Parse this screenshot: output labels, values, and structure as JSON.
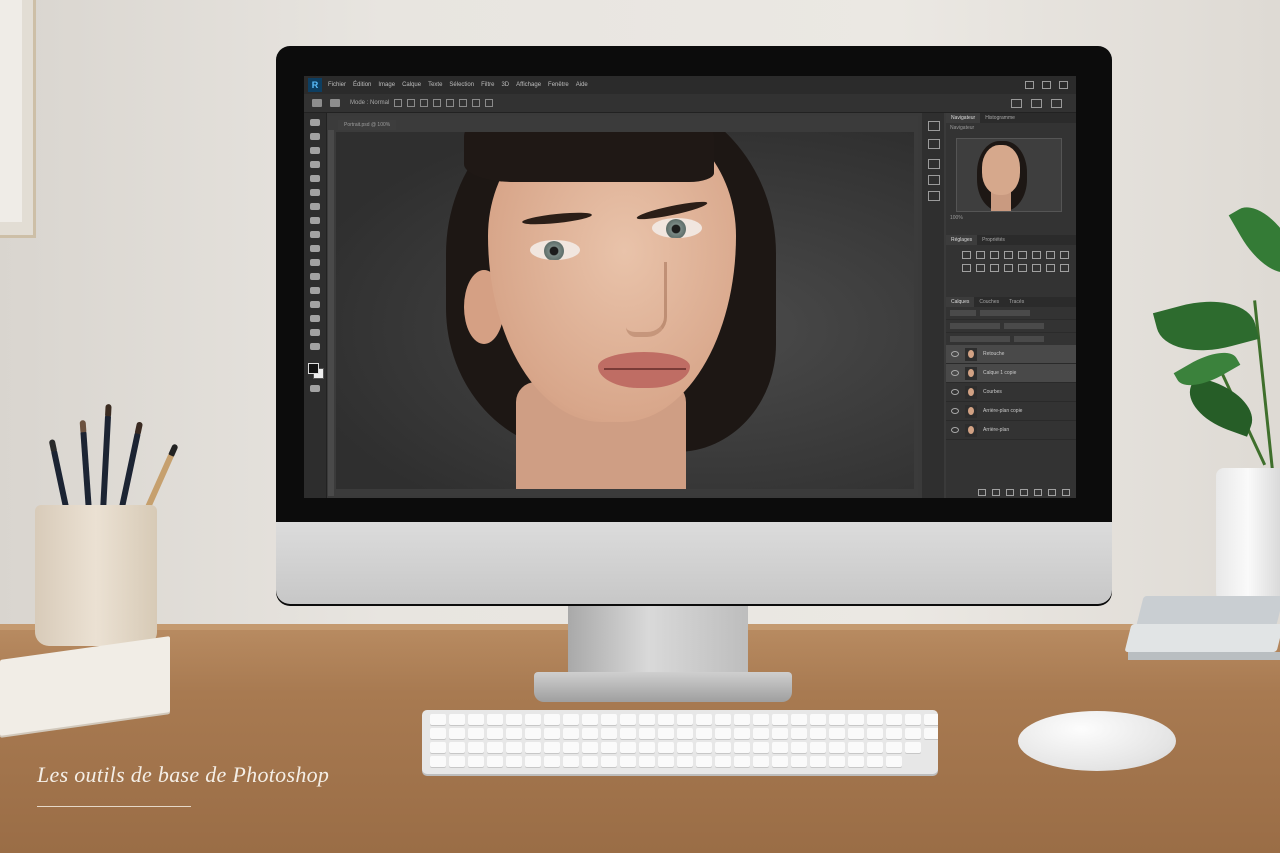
{
  "caption": "Les outils de base de Photoshop",
  "app": {
    "logo_text": "R",
    "menu": [
      "Fichier",
      "Édition",
      "Image",
      "Calque",
      "Texte",
      "Sélection",
      "Filtre",
      "3D",
      "Affichage",
      "Fenêtre",
      "Aide"
    ],
    "options_text": "Mode : Normal",
    "document_tab": "Portrait.psd @ 100%",
    "panels": {
      "navigator_tabs": [
        "Navigateur",
        "Histogramme"
      ],
      "navigator_label": "Navigateur",
      "zoom": "100%",
      "adjustments_tabs": [
        "Réglages",
        "Propriétés"
      ],
      "layers_tabs": [
        "Calques",
        "Couches",
        "Tracés"
      ],
      "layers": [
        {
          "name": "Retouche",
          "selected": true
        },
        {
          "name": "Calque 1 copie",
          "selected": true
        },
        {
          "name": "Courbes",
          "selected": false
        },
        {
          "name": "Arrière-plan copie",
          "selected": false
        },
        {
          "name": "Arrière-plan",
          "selected": false
        }
      ]
    }
  },
  "colors": {
    "ps_dark": "#2b2b2b",
    "ps_panel": "#333333",
    "desk": "#a87a51",
    "wall": "#e8e5e0"
  }
}
